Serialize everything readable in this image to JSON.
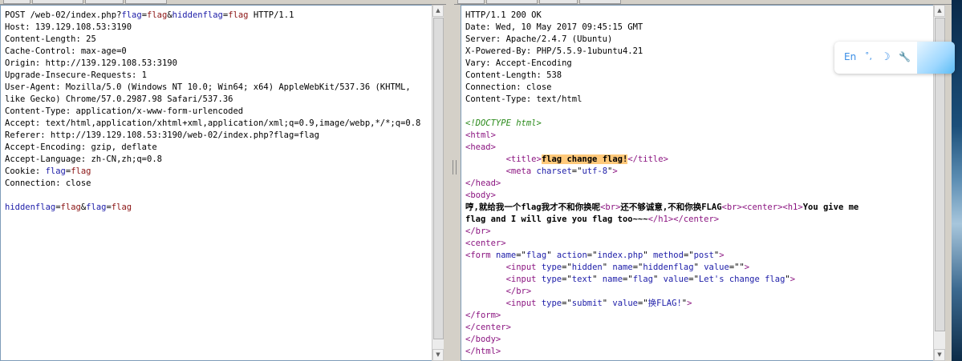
{
  "request": {
    "lines": [
      [
        {
          "t": "POST /web-02/index.php?"
        },
        {
          "t": "flag",
          "c": "k"
        },
        {
          "t": "="
        },
        {
          "t": "flag",
          "c": "v"
        },
        {
          "t": "&"
        },
        {
          "t": "hiddenflag",
          "c": "k"
        },
        {
          "t": "="
        },
        {
          "t": "flag",
          "c": "v"
        },
        {
          "t": " HTTP/1.1"
        }
      ],
      [
        {
          "t": "Host: 139.129.108.53:3190"
        }
      ],
      [
        {
          "t": "Content-Length: 25"
        }
      ],
      [
        {
          "t": "Cache-Control: max-age=0"
        }
      ],
      [
        {
          "t": "Origin: http://139.129.108.53:3190"
        }
      ],
      [
        {
          "t": "Upgrade-Insecure-Requests: 1"
        }
      ],
      [
        {
          "t": "User-Agent: Mozilla/5.0 (Windows NT 10.0; Win64; x64) AppleWebKit/537.36 (KHTML,"
        }
      ],
      [
        {
          "t": "like Gecko) Chrome/57.0.2987.98 Safari/537.36"
        }
      ],
      [
        {
          "t": "Content-Type: application/x-www-form-urlencoded"
        }
      ],
      [
        {
          "t": "Accept: text/html,application/xhtml+xml,application/xml;q=0.9,image/webp,*/*;q=0.8"
        }
      ],
      [
        {
          "t": "Referer: http://139.129.108.53:3190/web-02/index.php?flag=flag"
        }
      ],
      [
        {
          "t": "Accept-Encoding: gzip, deflate"
        }
      ],
      [
        {
          "t": "Accept-Language: zh-CN,zh;q=0.8"
        }
      ],
      [
        {
          "t": "Cookie: "
        },
        {
          "t": "flag",
          "c": "k"
        },
        {
          "t": "="
        },
        {
          "t": "flag",
          "c": "v"
        }
      ],
      [
        {
          "t": "Connection: close"
        }
      ],
      [
        {
          "t": ""
        }
      ],
      [
        {
          "t": "hiddenflag",
          "c": "k"
        },
        {
          "t": "="
        },
        {
          "t": "flag",
          "c": "v"
        },
        {
          "t": "&"
        },
        {
          "t": "flag",
          "c": "k"
        },
        {
          "t": "="
        },
        {
          "t": "flag",
          "c": "v"
        }
      ]
    ]
  },
  "response": {
    "lines": [
      [
        {
          "t": "HTTP/1.1 200 OK"
        }
      ],
      [
        {
          "t": "Date: Wed, 10 May 2017 09:45:15 GMT"
        }
      ],
      [
        {
          "t": "Server: Apache/2.4.7 (Ubuntu)"
        }
      ],
      [
        {
          "t": "X-Powered-By: PHP/5.5.9-1ubuntu4.21"
        }
      ],
      [
        {
          "t": "Vary: Accept-Encoding"
        }
      ],
      [
        {
          "t": "Content-Length: 538"
        }
      ],
      [
        {
          "t": "Connection: close"
        }
      ],
      [
        {
          "t": "Content-Type: text/html"
        }
      ],
      [
        {
          "t": ""
        }
      ],
      [
        {
          "t": "<!DOCTYPE html>",
          "c": "c"
        }
      ],
      [
        {
          "t": "<html>",
          "c": "t"
        }
      ],
      [
        {
          "t": "<head>",
          "c": "t"
        }
      ],
      [
        {
          "t": "        "
        },
        {
          "t": "<title>",
          "c": "t"
        },
        {
          "t": "flag change flag!",
          "c": "hl"
        },
        {
          "t": "</title>",
          "c": "t"
        }
      ],
      [
        {
          "t": "        "
        },
        {
          "t": "<meta ",
          "c": "t"
        },
        {
          "t": "charset",
          "c": "k"
        },
        {
          "t": "=\""
        },
        {
          "t": "utf-8",
          "c": "s"
        },
        {
          "t": "\""
        },
        {
          "t": ">",
          "c": "t"
        }
      ],
      [
        {
          "t": "</head>",
          "c": "t"
        }
      ],
      [
        {
          "t": "<body>",
          "c": "t"
        }
      ],
      [
        {
          "t": "哼,就给我一个flag我才不和你换呢",
          "c": "b"
        },
        {
          "t": "<br>",
          "c": "t"
        },
        {
          "t": "还不够诚意,不和你换FLAG",
          "c": "b"
        },
        {
          "t": "<br>",
          "c": "t"
        },
        {
          "t": "<center>",
          "c": "t"
        },
        {
          "t": "<h1>",
          "c": "t"
        },
        {
          "t": "You give me",
          "c": "b"
        }
      ],
      [
        {
          "t": "flag and I will give you flag too~~~",
          "c": "b"
        },
        {
          "t": "</h1>",
          "c": "t"
        },
        {
          "t": "</center>",
          "c": "t"
        }
      ],
      [
        {
          "t": "</br>",
          "c": "t"
        }
      ],
      [
        {
          "t": "<center>",
          "c": "t"
        }
      ],
      [
        {
          "t": "<form ",
          "c": "t"
        },
        {
          "t": "name",
          "c": "k"
        },
        {
          "t": "=\""
        },
        {
          "t": "flag",
          "c": "s"
        },
        {
          "t": "\" "
        },
        {
          "t": "action",
          "c": "k"
        },
        {
          "t": "=\""
        },
        {
          "t": "index.php",
          "c": "s"
        },
        {
          "t": "\" "
        },
        {
          "t": "method",
          "c": "k"
        },
        {
          "t": "=\""
        },
        {
          "t": "post",
          "c": "s"
        },
        {
          "t": "\""
        },
        {
          "t": ">",
          "c": "t"
        }
      ],
      [
        {
          "t": "        "
        },
        {
          "t": "<input ",
          "c": "t"
        },
        {
          "t": "type",
          "c": "k"
        },
        {
          "t": "=\""
        },
        {
          "t": "hidden",
          "c": "s"
        },
        {
          "t": "\" "
        },
        {
          "t": "name",
          "c": "k"
        },
        {
          "t": "=\""
        },
        {
          "t": "hiddenflag",
          "c": "s"
        },
        {
          "t": "\" "
        },
        {
          "t": "value",
          "c": "k"
        },
        {
          "t": "=\"\""
        },
        {
          "t": ">",
          "c": "t"
        }
      ],
      [
        {
          "t": "        "
        },
        {
          "t": "<input ",
          "c": "t"
        },
        {
          "t": "type",
          "c": "k"
        },
        {
          "t": "=\""
        },
        {
          "t": "text",
          "c": "s"
        },
        {
          "t": "\" "
        },
        {
          "t": "name",
          "c": "k"
        },
        {
          "t": "=\""
        },
        {
          "t": "flag",
          "c": "s"
        },
        {
          "t": "\" "
        },
        {
          "t": "value",
          "c": "k"
        },
        {
          "t": "=\""
        },
        {
          "t": "Let's change flag",
          "c": "s"
        },
        {
          "t": "\""
        },
        {
          "t": ">",
          "c": "t"
        }
      ],
      [
        {
          "t": "        "
        },
        {
          "t": "</br>",
          "c": "t"
        }
      ],
      [
        {
          "t": "        "
        },
        {
          "t": "<input ",
          "c": "t"
        },
        {
          "t": "type",
          "c": "k"
        },
        {
          "t": "=\""
        },
        {
          "t": "submit",
          "c": "s"
        },
        {
          "t": "\" "
        },
        {
          "t": "value",
          "c": "k"
        },
        {
          "t": "=\""
        },
        {
          "t": "换FLAG!",
          "c": "s"
        },
        {
          "t": "\""
        },
        {
          "t": ">",
          "c": "t"
        }
      ],
      [
        {
          "t": "</form>",
          "c": "t"
        }
      ],
      [
        {
          "t": "</center>",
          "c": "t"
        }
      ],
      [
        {
          "t": "</body>",
          "c": "t"
        }
      ],
      [
        {
          "t": "</html>",
          "c": "t"
        }
      ]
    ]
  },
  "ime_toolbar": {
    "language": "En",
    "punct_icon": "punctuation-icon",
    "mode_icon": "moon-icon",
    "settings_icon": "wrench-icon"
  },
  "colors": {
    "param_name": "#1c1ca8",
    "param_value": "#8b1414",
    "tag": "#8b1480",
    "doctype": "#2a8a1a",
    "highlight": "#ffc97a"
  }
}
